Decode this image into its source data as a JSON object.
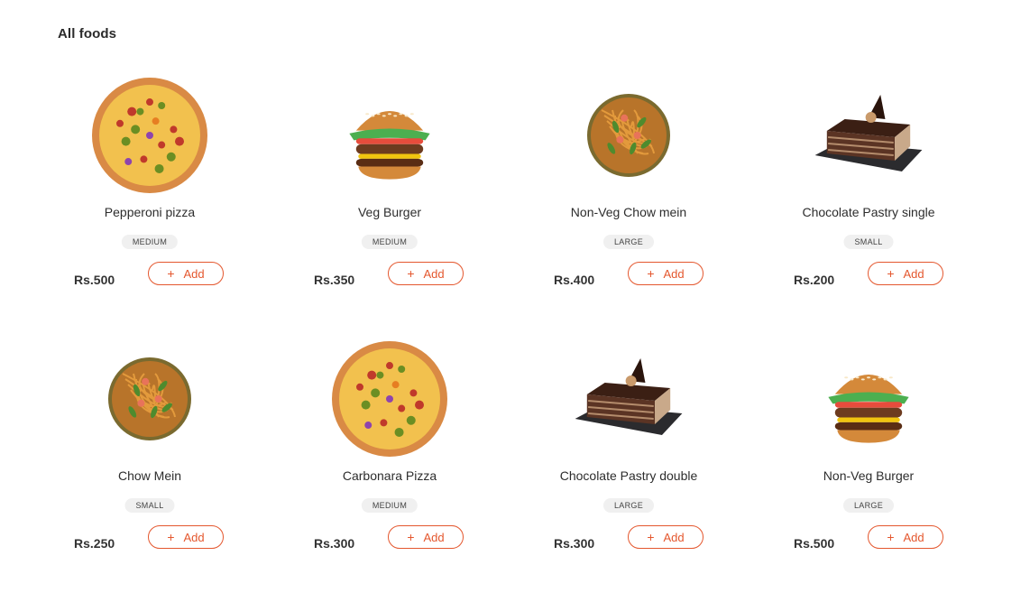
{
  "section": {
    "title": "All foods"
  },
  "colors": {
    "accent": "#e4572e",
    "badge_bg": "#f0f0f0"
  },
  "add_label": "Add",
  "add_icon": "plus-icon",
  "foods": [
    {
      "name": "Pepperoni pizza",
      "size": "MEDIUM",
      "price": "Rs.500",
      "image": "pizza"
    },
    {
      "name": "Veg Burger",
      "size": "MEDIUM",
      "price": "Rs.350",
      "image": "burger"
    },
    {
      "name": "Non-Veg Chow mein",
      "size": "LARGE",
      "price": "Rs.400",
      "image": "chowmein"
    },
    {
      "name": "Chocolate Pastry single",
      "size": "SMALL",
      "price": "Rs.200",
      "image": "pastry"
    },
    {
      "name": "Chow Mein",
      "size": "SMALL",
      "price": "Rs.250",
      "image": "chowmein"
    },
    {
      "name": "Carbonara Pizza",
      "size": "MEDIUM",
      "price": "Rs.300",
      "image": "pizza"
    },
    {
      "name": "Chocolate Pastry double",
      "size": "LARGE",
      "price": "Rs.300",
      "image": "pastry"
    },
    {
      "name": "Non-Veg Burger",
      "size": "LARGE",
      "price": "Rs.500",
      "image": "burger"
    }
  ]
}
